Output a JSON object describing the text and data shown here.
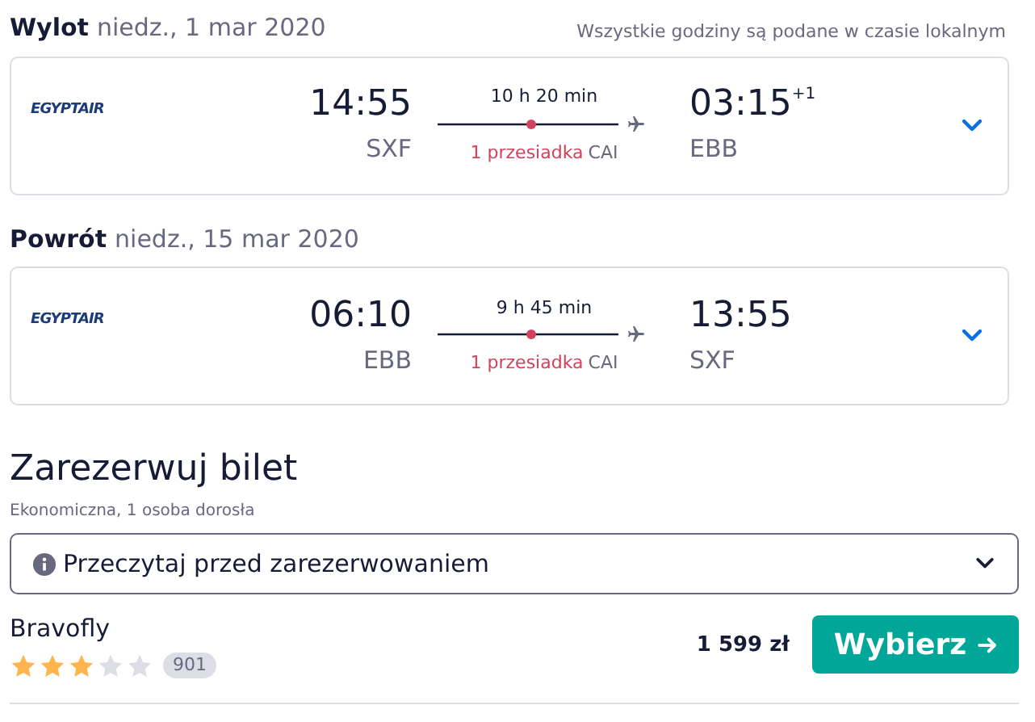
{
  "legs": [
    {
      "label": "Wylot",
      "date": "niedz., 1 mar 2020",
      "note": "Wszystkie godziny są podane w czasie lokalnym",
      "airline": "EGYPTAIR",
      "departure_time": "14:55",
      "departure_airport": "SXF",
      "duration": "10 h 20 min",
      "stops": "1 przesiadka",
      "stop_airport": "CAI",
      "arrival_time": "03:15",
      "arrival_day_offset": "+1",
      "arrival_airport": "EBB",
      "expanded": false
    },
    {
      "label": "Powrót",
      "date": "niedz., 15 mar 2020",
      "airline": "EGYPTAIR",
      "departure_time": "06:10",
      "departure_airport": "EBB",
      "duration": "9 h 45 min",
      "stops": "1 przesiadka",
      "stop_airport": "CAI",
      "arrival_time": "13:55",
      "arrival_airport": "SXF",
      "expanded": false
    }
  ],
  "booking": {
    "title": "Zarezerwuj bilet",
    "subtitle": "Ekonomiczna, 1 osoba dorosła",
    "notice": {
      "label": "Przeczytaj przed zarezerwowaniem",
      "expanded": false
    },
    "offers": [
      {
        "provider": "Bravofly",
        "stars": 3,
        "reviews": "901",
        "price": "1 599 zł",
        "button": "Wybierz"
      }
    ]
  }
}
